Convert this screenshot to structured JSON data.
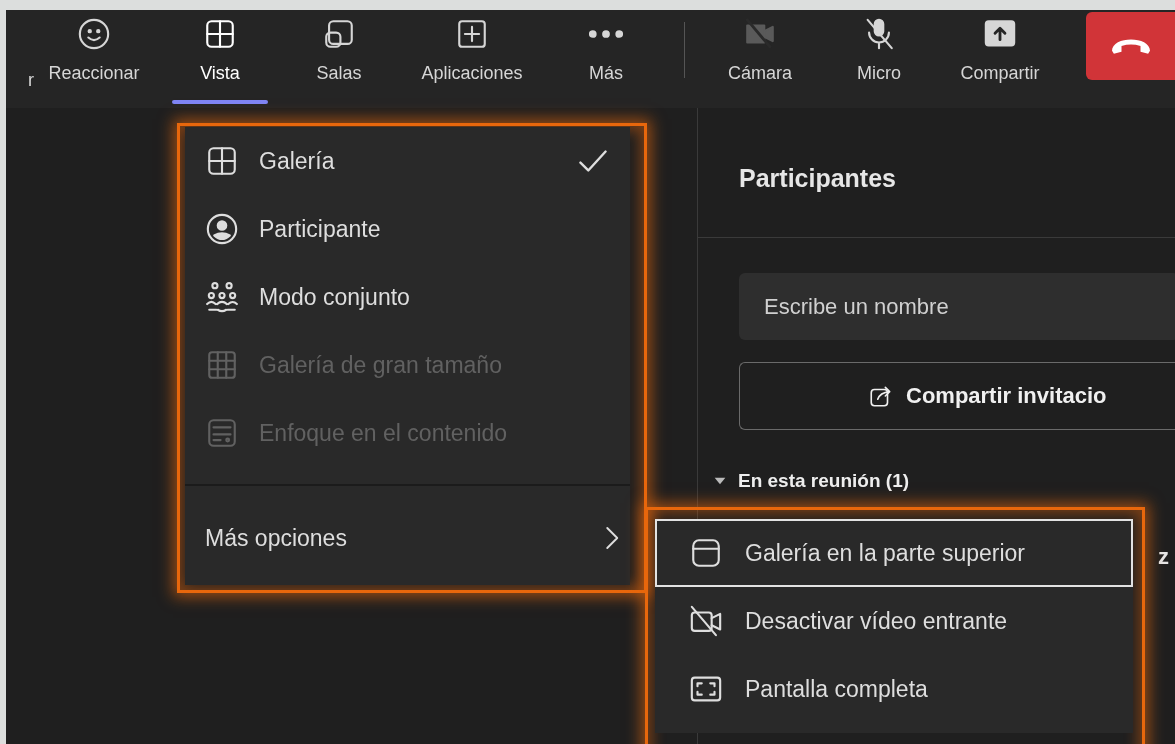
{
  "toolbar": {
    "cut_label": "r",
    "items": [
      {
        "label": "Reaccionar",
        "selected": false
      },
      {
        "label": "Vista",
        "selected": true
      },
      {
        "label": "Salas",
        "selected": false
      },
      {
        "label": "Aplicaciones",
        "selected": false
      },
      {
        "label": "Más",
        "selected": false
      },
      {
        "label": "Cámara",
        "selected": false
      },
      {
        "label": "Micro",
        "selected": false
      },
      {
        "label": "Compartir",
        "selected": false
      }
    ]
  },
  "view_menu": {
    "items": [
      {
        "label": "Galería",
        "selected": true,
        "disabled": false
      },
      {
        "label": "Participante",
        "selected": false,
        "disabled": false
      },
      {
        "label": "Modo conjunto",
        "selected": false,
        "disabled": false
      },
      {
        "label": "Galería de gran tamaño",
        "selected": false,
        "disabled": true
      },
      {
        "label": "Enfoque en el contenido",
        "selected": false,
        "disabled": true
      }
    ],
    "more_options": {
      "label": "Más opciones"
    }
  },
  "submenu": {
    "items": [
      {
        "label": "Galería en la parte superior",
        "focused": true
      },
      {
        "label": "Desactivar vídeo entrante",
        "focused": false
      },
      {
        "label": "Pantalla completa",
        "focused": false
      }
    ]
  },
  "participants": {
    "title": "Participantes",
    "search": {
      "placeholder": "Escribe un nombre"
    },
    "invite_button": "Compartir invitacio",
    "section": {
      "label": "En esta reunión (1)",
      "expanded": true
    },
    "cut_name": "z"
  }
}
